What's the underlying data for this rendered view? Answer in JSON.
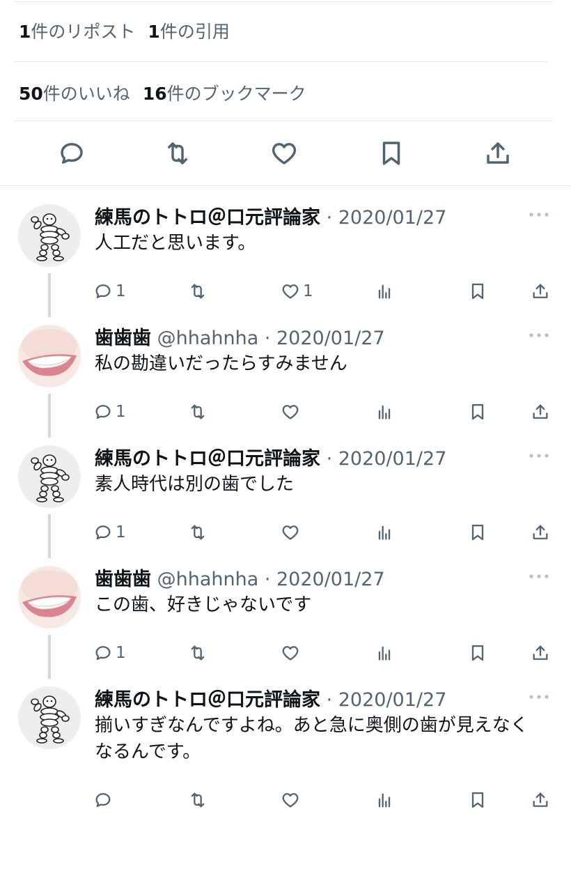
{
  "stats": {
    "reposts_count": "1",
    "reposts_label": "件のリポスト",
    "quotes_count": "1",
    "quotes_label": "件の引用",
    "likes_count": "50",
    "likes_label": "件のいいね",
    "bookmarks_count": "16",
    "bookmarks_label": "件のブックマーク"
  },
  "action_bar": [
    "reply-icon",
    "repost-icon",
    "like-icon",
    "bookmark-icon",
    "share-icon"
  ],
  "colors": {
    "text": "#0f1419",
    "secondary": "#536471",
    "divider": "#e6e9ec",
    "thread": "#cfd9de"
  },
  "replies": [
    {
      "display_name": "練馬のトトロ＠口元評論家",
      "handle": "",
      "date": "2020/01/27",
      "text": "人工だと思います。",
      "reply_count": "1",
      "like_count": "1",
      "avatar": "michelin-avatar"
    },
    {
      "display_name": "歯歯歯",
      "handle": "@hhahnha",
      "date": "2020/01/27",
      "text": "私の勘違いだったらすみません",
      "reply_count": "1",
      "like_count": "",
      "avatar": "smile-avatar"
    },
    {
      "display_name": "練馬のトトロ＠口元評論家",
      "handle": "",
      "date": "2020/01/27",
      "text": "素人時代は別の歯でした",
      "reply_count": "1",
      "like_count": "",
      "avatar": "michelin-avatar"
    },
    {
      "display_name": "歯歯歯",
      "handle": "@hhahnha",
      "date": "2020/01/27",
      "text": "この歯、好きじゃないです",
      "reply_count": "1",
      "like_count": "",
      "avatar": "smile-avatar"
    },
    {
      "display_name": "練馬のトトロ＠口元評論家",
      "handle": "",
      "date": "2020/01/27",
      "text": "揃いすぎなんですよね。あと急に奥側の歯が見えなくなるんです。",
      "reply_count": "",
      "like_count": "",
      "avatar": "michelin-avatar"
    }
  ]
}
